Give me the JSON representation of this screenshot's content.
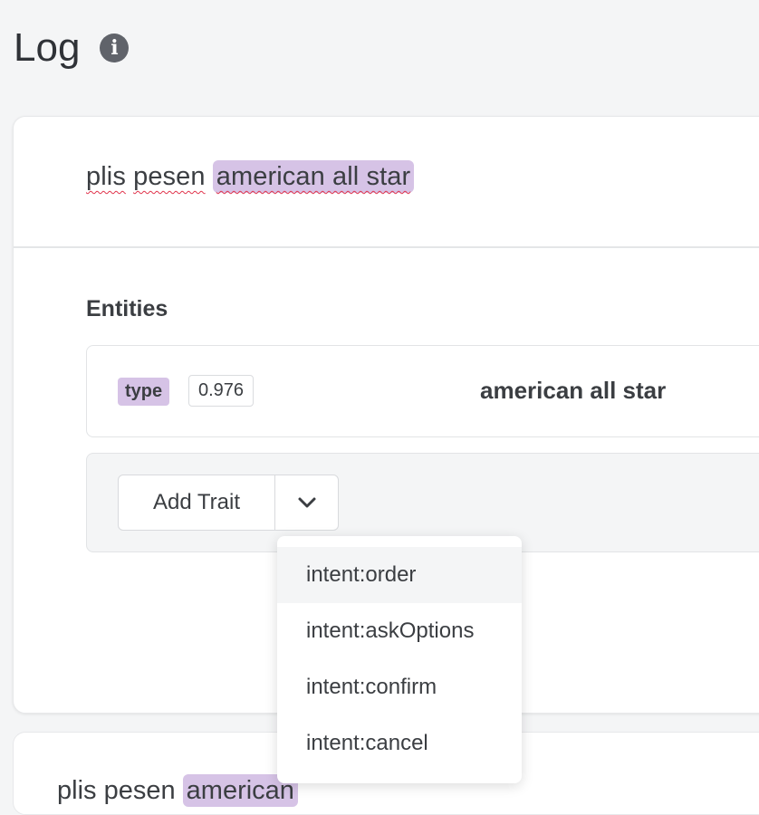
{
  "page": {
    "title": "Log",
    "info_icon": "info-icon"
  },
  "log_entry": {
    "utterance_plain_1": "plis",
    "utterance_plain_2": "pesen",
    "utterance_entity": "american all star",
    "entities_title": "Entities",
    "entity": {
      "tag": "type",
      "confidence": "0.976",
      "value": "american all star"
    },
    "add_trait_label": "Add Trait",
    "dropdown_toggle_icon": "chevron-down-icon"
  },
  "trait_menu": {
    "items": [
      {
        "label": "intent:order",
        "active": true
      },
      {
        "label": "intent:askOptions",
        "active": false
      },
      {
        "label": "intent:confirm",
        "active": false
      },
      {
        "label": "intent:cancel",
        "active": false
      }
    ]
  },
  "next_entry": {
    "utterance_plain": "plis pesen",
    "utterance_entity": "american"
  },
  "colors": {
    "entity_highlight": "#d6c3e6",
    "background": "#f4f5f6",
    "spellcheck": "#e0334b"
  }
}
